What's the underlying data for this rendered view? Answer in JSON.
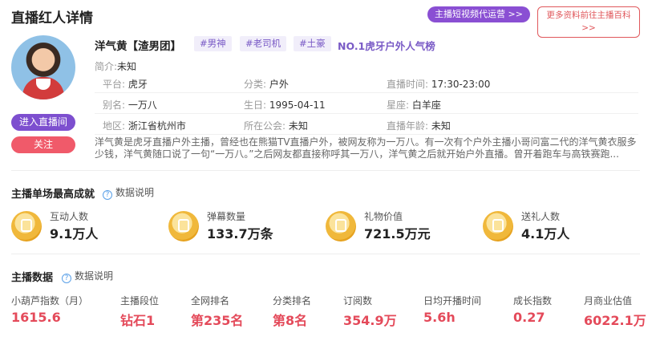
{
  "header": {
    "title": "直播红人详情",
    "agency_button": "主播短视频代运营 >>",
    "baike_button": "更多资料前往主播百科 >>"
  },
  "profile": {
    "name": "洋气黄【渣男团】",
    "tags": [
      "#男神",
      "#老司机",
      "#土豪"
    ],
    "rank_text": "NO.1虎牙户外人气榜",
    "intro_label": "简介:",
    "intro_value": "未知",
    "live_button": "进入直播间",
    "follow_button": "关注",
    "info": [
      [
        {
          "label": "平台:",
          "value": "虎牙"
        },
        {
          "label": "分类:",
          "value": "户外"
        },
        {
          "label": "直播时间:",
          "value": "17:30-23:00"
        }
      ],
      [
        {
          "label": "别名:",
          "value": "一万八"
        },
        {
          "label": "生日:",
          "value": "1995-04-11"
        },
        {
          "label": "星座:",
          "value": "白羊座"
        }
      ],
      [
        {
          "label": "地区:",
          "value": "浙江省杭州市"
        },
        {
          "label": "所在公会:",
          "value": "未知"
        },
        {
          "label": "直播年龄:",
          "value": "未知"
        }
      ]
    ],
    "description": "洋气黄是虎牙直播户外主播，曾经也在熊猫TV直播户外，被网友称为一万八。有一次有个户外主播小哥问富二代的洋气黄衣服多少钱，洋气黄随口说了一句“一万八。”之后网友都直接称呼其一万八，洋气黄之后就开始户外直播。曾开着跑车与高铁赛跑..."
  },
  "best_single": {
    "title": "主播单场最高成就",
    "help": "数据说明",
    "stats": [
      {
        "label": "互动人数",
        "value": "9.1万人",
        "icon": "people-coin-icon"
      },
      {
        "label": "弹幕数量",
        "value": "133.7万条",
        "icon": "chat-coin-icon"
      },
      {
        "label": "礼物价值",
        "value": "721.5万元",
        "icon": "crown-coin-icon"
      },
      {
        "label": "送礼人数",
        "value": "4.1万人",
        "icon": "gift-coin-icon"
      }
    ]
  },
  "anchor_data": {
    "title": "主播数据",
    "help": "数据说明",
    "metrics": [
      {
        "label": "小葫芦指数（月）",
        "value": "1615.6"
      },
      {
        "label": "主播段位",
        "value": "钻石1"
      },
      {
        "label": "全网排名",
        "value": "第235名"
      },
      {
        "label": "分类排名",
        "value": "第8名"
      },
      {
        "label": "订阅数",
        "value": "354.9万"
      },
      {
        "label": "日均开播时间",
        "value": "5.6h"
      },
      {
        "label": "成长指数",
        "value": "0.27"
      },
      {
        "label": "月商业估值",
        "value": "6022.1万"
      }
    ]
  },
  "colors": {
    "accent_purple": "#7d4fcf",
    "accent_red": "#e44a5a",
    "coin_gold": "#f0b83b"
  }
}
